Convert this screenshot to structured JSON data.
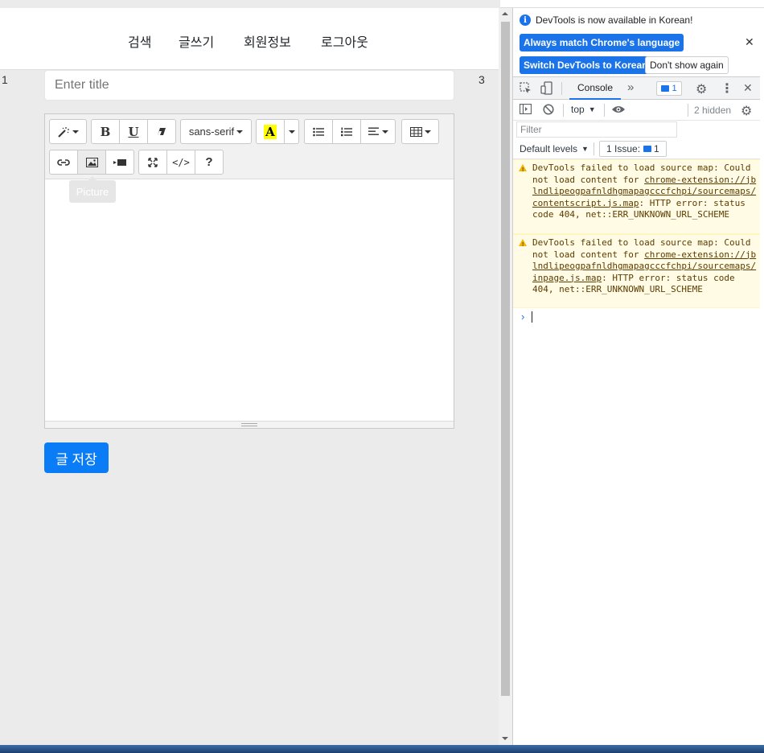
{
  "nav": {
    "items": [
      "검색",
      "글쓰기",
      "회원정보",
      "로그아웃"
    ]
  },
  "side_numbers": {
    "left": "1",
    "right": "3"
  },
  "title_input": {
    "placeholder": "Enter title",
    "value": ""
  },
  "editor": {
    "toolbar": {
      "style_icon": "magic-wand-icon",
      "bold_label": "B",
      "underline_label": "U",
      "eraser_icon": "eraser-icon",
      "font_family_label": "sans-serif",
      "color_label": "A",
      "ul_icon": "unordered-list-icon",
      "ol_icon": "ordered-list-icon",
      "align_icon": "align-left-icon",
      "table_icon": "table-icon",
      "link_icon": "link-icon",
      "picture_icon": "picture-icon",
      "video_icon": "video-icon",
      "fullscreen_icon": "expand-icon",
      "codeview_label": "</>",
      "help_label": "?"
    },
    "tooltip": "Picture",
    "content": ""
  },
  "save_button": {
    "label": "글 저장"
  },
  "colors": {
    "primary": "#0a7cf6",
    "devtools_blue": "#1a73e8",
    "warning_bg": "#fffbe5",
    "page_bg": "#ebebeb"
  },
  "devtools": {
    "info_message": "DevTools is now available in Korean!",
    "buttons": {
      "match_language": "Always match Chrome's language",
      "switch_korean": "Switch DevTools to Korean",
      "dont_show": "Don't show again"
    },
    "tabs": {
      "console": "Console",
      "more": "»"
    },
    "issues_badge": "1",
    "context": "top",
    "hidden_count": "2 hidden",
    "filter_placeholder": "Filter",
    "default_levels": "Default levels",
    "issue_label": "1 Issue:",
    "issue_count": "1",
    "messages": [
      {
        "pre": "DevTools failed to load source map: Could not load content for ",
        "link": "chrome-extension://jblndlipeogpafnldhgmapagcccfchpi/sourcemaps/contentscript.js.map",
        "post": ": HTTP error: status code 404, net::ERR_UNKNOWN_URL_SCHEME"
      },
      {
        "pre": "DevTools failed to load source map: Could not load content for ",
        "link": "chrome-extension://jblndlipeogpafnldhgmapagcccfchpi/sourcemaps/inpage.js.map",
        "post": ": HTTP error: status code 404, net::ERR_UNKNOWN_URL_SCHEME"
      }
    ],
    "prompt_symbol": "›"
  }
}
